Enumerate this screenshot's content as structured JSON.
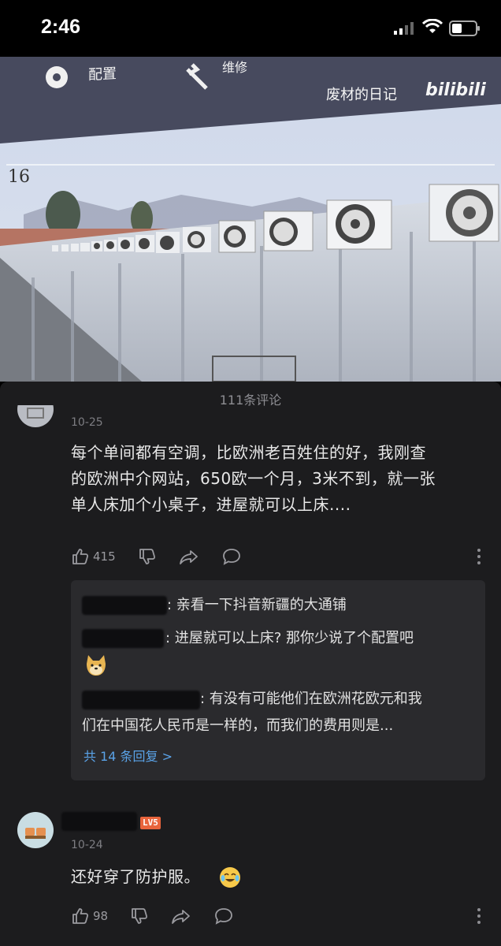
{
  "status_bar": {
    "time": "2:46"
  },
  "video": {
    "watermark": "废材的日记",
    "bilibili_logo": "bilibili",
    "toolbar_config": "配置",
    "toolbar_comment_partial": "维修",
    "camera_number": "16"
  },
  "comments_header": {
    "count_label": "111条评论"
  },
  "comments": [
    {
      "date": "10-25",
      "text_lines": [
        "每个单间都有空调，比欧洲老百姓住的好，我刚查",
        "的欧洲中介网站，650欧一个月，3米不到，就一张",
        "单人床加个小桌子，进屋就可以上床...."
      ],
      "likes": "415",
      "replies": [
        {
          "text": ": 亲看一下抖音新疆的大通铺"
        },
        {
          "text": ": 进屋就可以上床? 那你少说了个配置吧"
        },
        {
          "text_lines": [
            ": 有没有可能他们在欧洲花欧元和我",
            "们在中国花人民币是一样的，而我们的费用则是..."
          ]
        }
      ],
      "more_replies": "共 14 条回复 >"
    },
    {
      "date": "10-24",
      "level_badge": "LV5",
      "text": "还好穿了防护服。",
      "likes": "98"
    }
  ]
}
